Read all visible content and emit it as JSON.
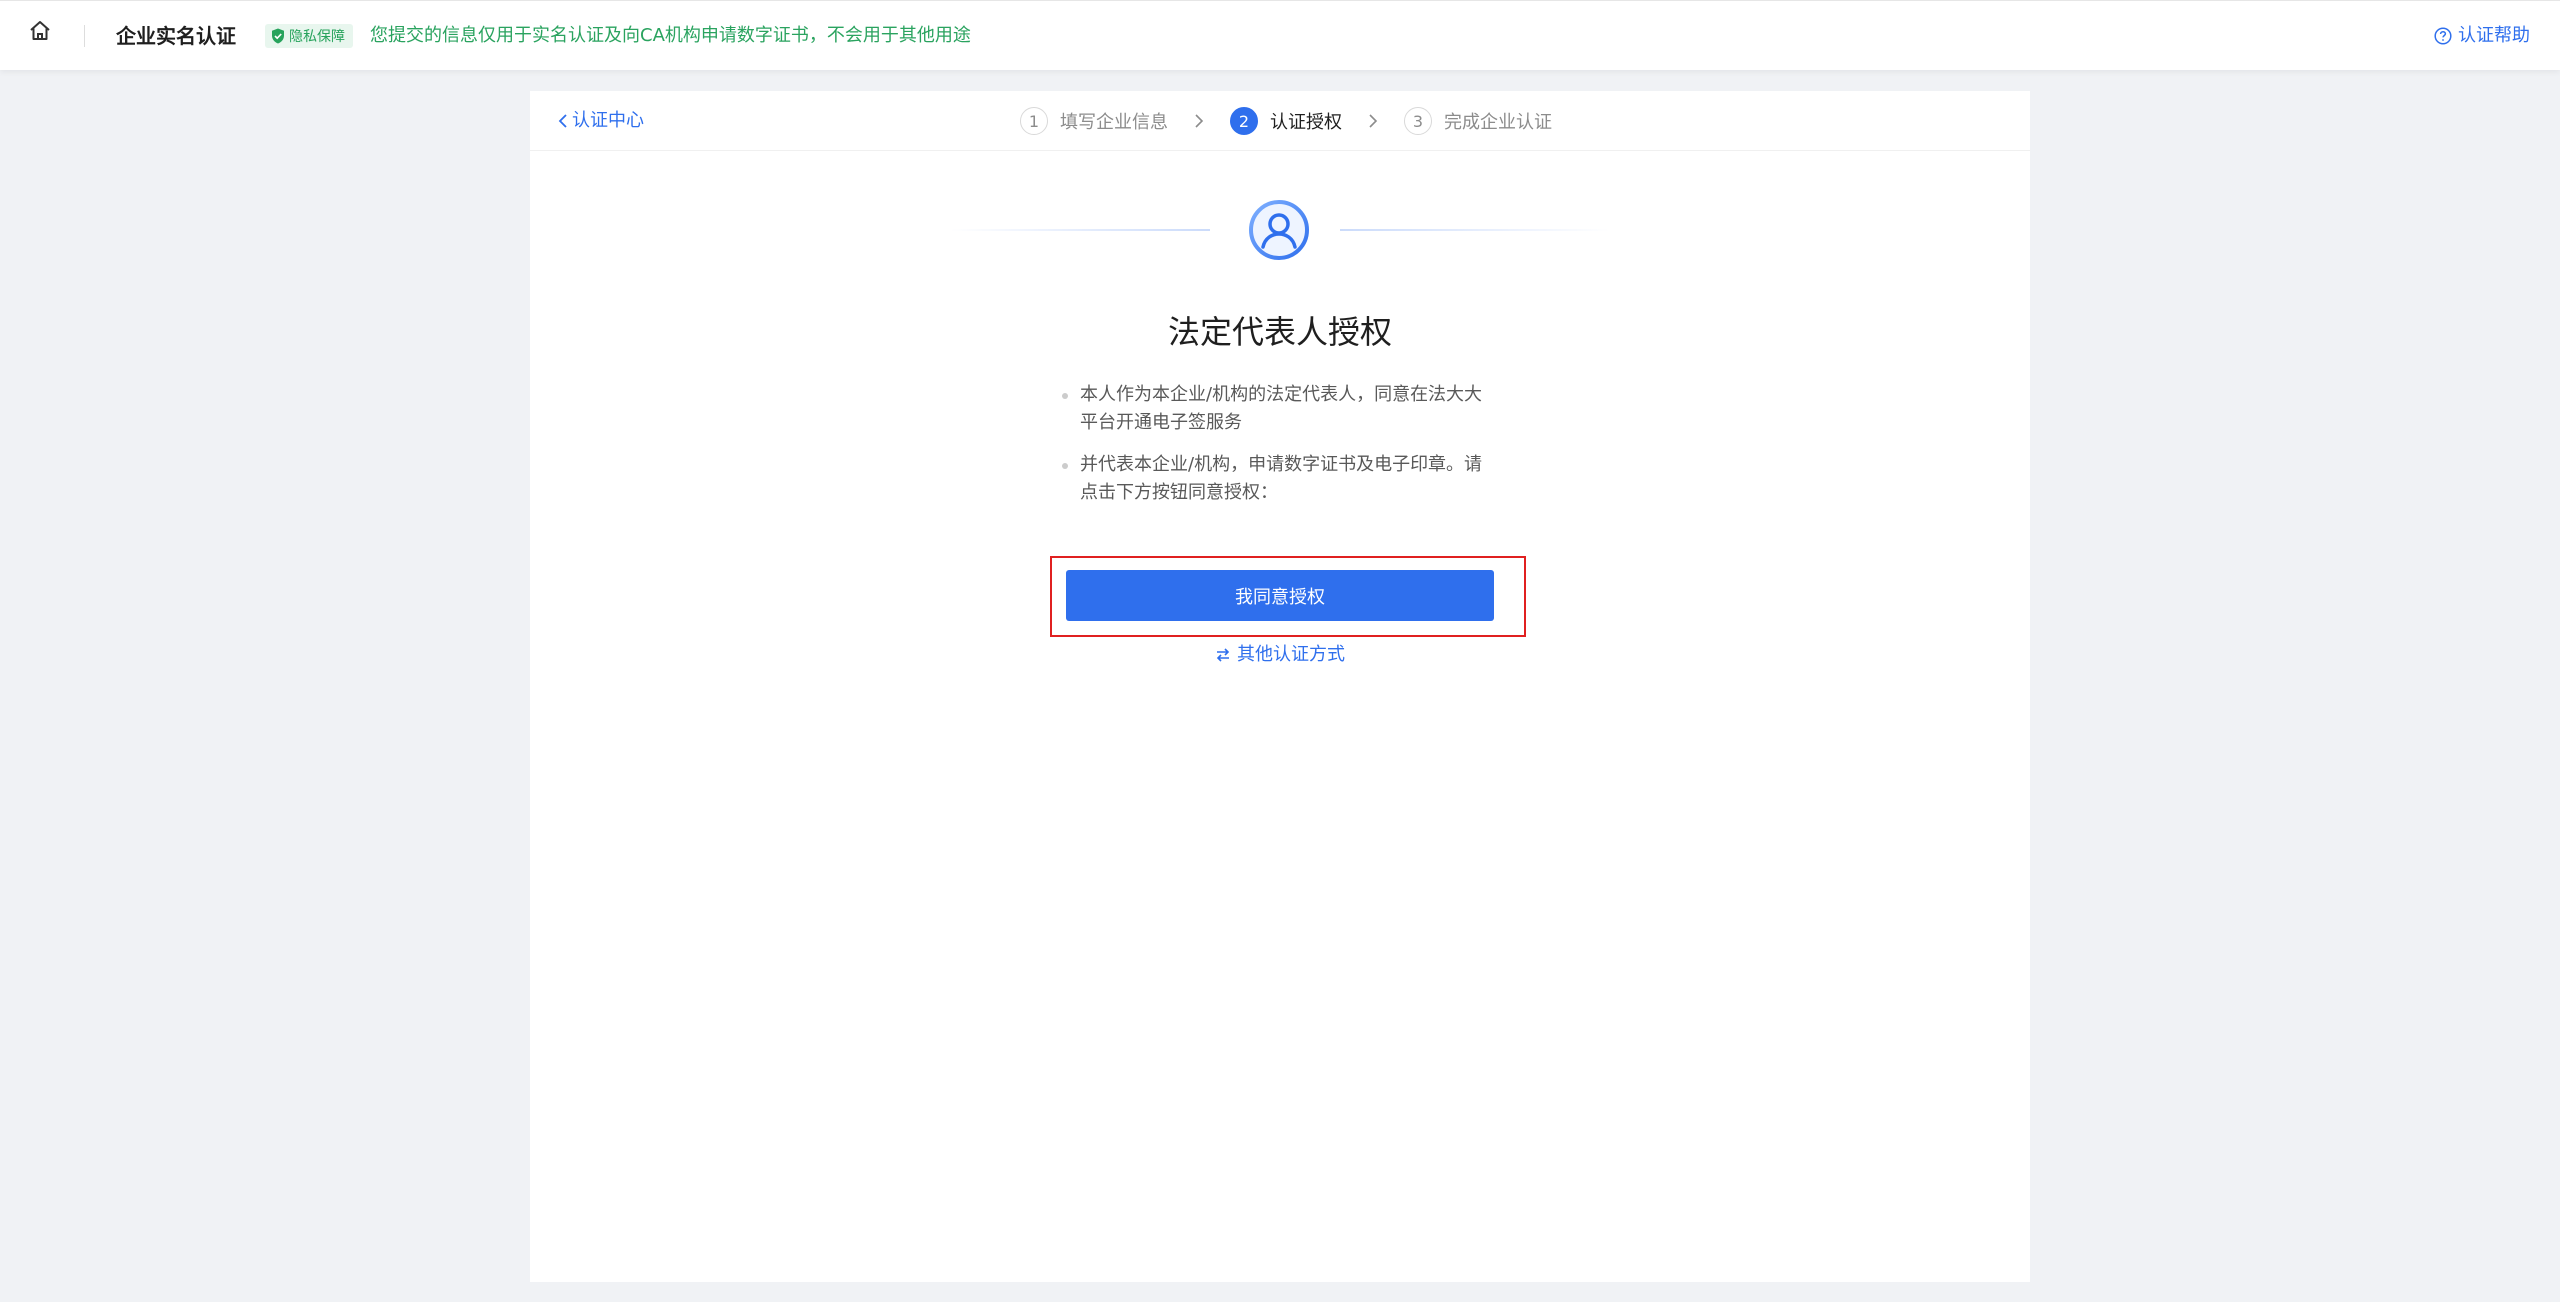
{
  "header": {
    "title": "企业实名认证",
    "privacy_badge": "隐私保障",
    "privacy_notice": "您提交的信息仅用于实名认证及向CA机构申请数字证书，不会用于其他用途",
    "help_link": "认证帮助"
  },
  "card": {
    "back_link": "认证中心",
    "steps": [
      {
        "number": "1",
        "label": "填写企业信息",
        "state": "done"
      },
      {
        "number": "2",
        "label": "认证授权",
        "state": "active"
      },
      {
        "number": "3",
        "label": "完成企业认证",
        "state": "pending"
      }
    ],
    "title": "法定代表人授权",
    "bullets": [
      "本人作为本企业/机构的法定代表人，同意在法大大平台开通电子签服务",
      "并代表本企业/机构，申请数字证书及电子印章。请点击下方按钮同意授权："
    ],
    "agree_button": "我同意授权",
    "other_methods": "其他认证方式"
  },
  "icons": {
    "home": "home-icon",
    "shield": "shield-check-icon",
    "help": "question-circle-icon",
    "back": "chevron-left-icon",
    "step_separator": "chevron-right-icon",
    "avatar": "user-circle-icon",
    "swap": "swap-arrows-icon"
  },
  "colors": {
    "primary": "#2f6fed",
    "privacy_green": "#2aa35f",
    "highlight_red": "#e02020",
    "background": "#f0f2f5"
  }
}
